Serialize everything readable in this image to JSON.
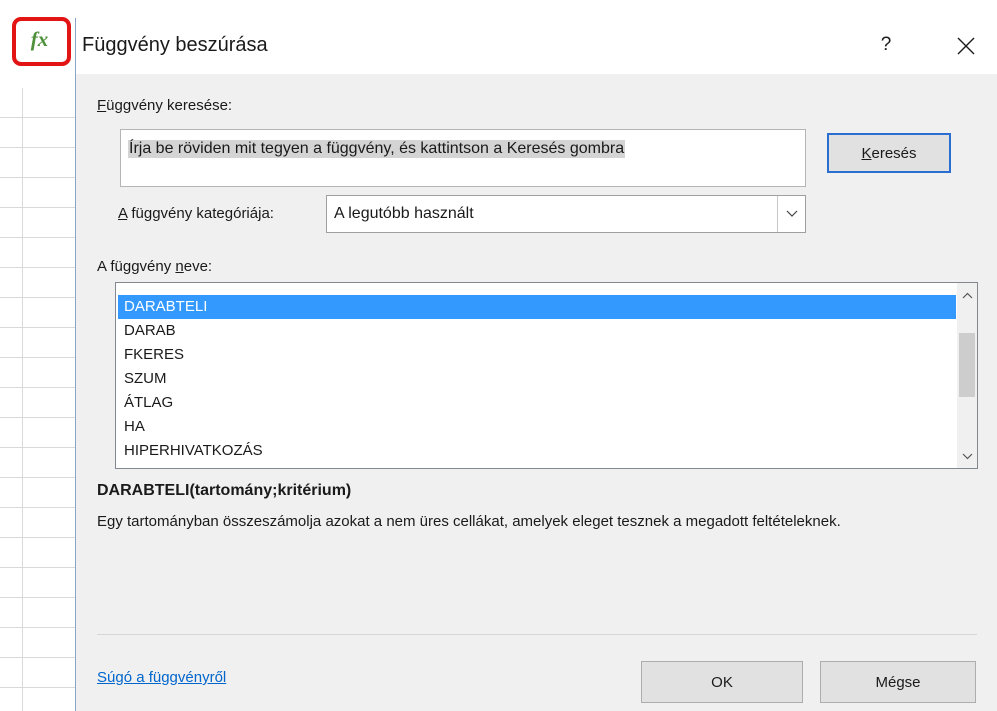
{
  "excel": {
    "formula_icon": "fx-icon"
  },
  "dialog": {
    "title": "Függvény beszúrása",
    "help_label": "?",
    "close_icon": "close-icon",
    "search": {
      "label_prefix": "",
      "label_accel": "F",
      "label_rest": "üggvény keresése:",
      "value": "Írja be röviden mit tegyen a függvény, és kattintson a Keresés gombra",
      "button_accel": "K",
      "button_rest": "eresés"
    },
    "category": {
      "label_accel": "A",
      "label_rest": " függvény kategóriája:",
      "selected": "A legutóbb használt",
      "arrow_icon": "chevron-down-icon"
    },
    "function_list": {
      "label_prefix": "A függvény ",
      "label_accel": "n",
      "label_rest": "eve:",
      "items": [
        "DARABTELI",
        "DARAB",
        "FKERES",
        "SZUM",
        "ÁTLAG",
        "HA",
        "HIPERHIVATKOZÁS"
      ],
      "selected_index": 0,
      "scroll_up_icon": "chevron-up-icon",
      "scroll_down_icon": "chevron-down-icon"
    },
    "syntax": "DARABTELI(tartomány;kritérium)",
    "description": "Egy tartományban összeszámolja azokat a nem üres cellákat, amelyek eleget tesznek a megadott feltételeknek.",
    "help_link": "Súgó a függvényről",
    "ok_label": "OK",
    "cancel_label": "Mégse"
  },
  "colors": {
    "selection": "#3399ff",
    "link": "#0066cc",
    "highlight_border": "#e31414",
    "fx_green": "#4e8f3a",
    "primary_border": "#2b6ed2"
  }
}
